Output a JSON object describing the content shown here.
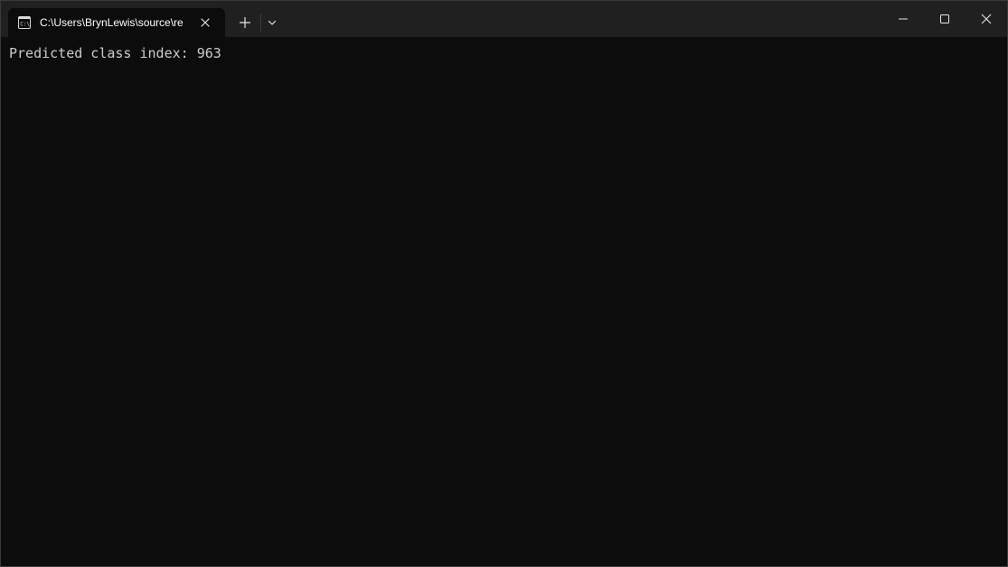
{
  "tab": {
    "icon": "command-prompt-icon",
    "title": "C:\\Users\\BrynLewis\\source\\re"
  },
  "icons": {
    "close_tab": "close-icon",
    "new_tab": "plus-icon",
    "dropdown": "chevron-down-icon",
    "minimize": "minimize-icon",
    "maximize": "maximize-icon",
    "close_window": "close-icon"
  },
  "terminal": {
    "lines": [
      "Predicted class index: 963"
    ]
  },
  "colors": {
    "titlebar": "#202020",
    "terminal_bg": "#0c0c0c",
    "text": "#cccccc"
  }
}
